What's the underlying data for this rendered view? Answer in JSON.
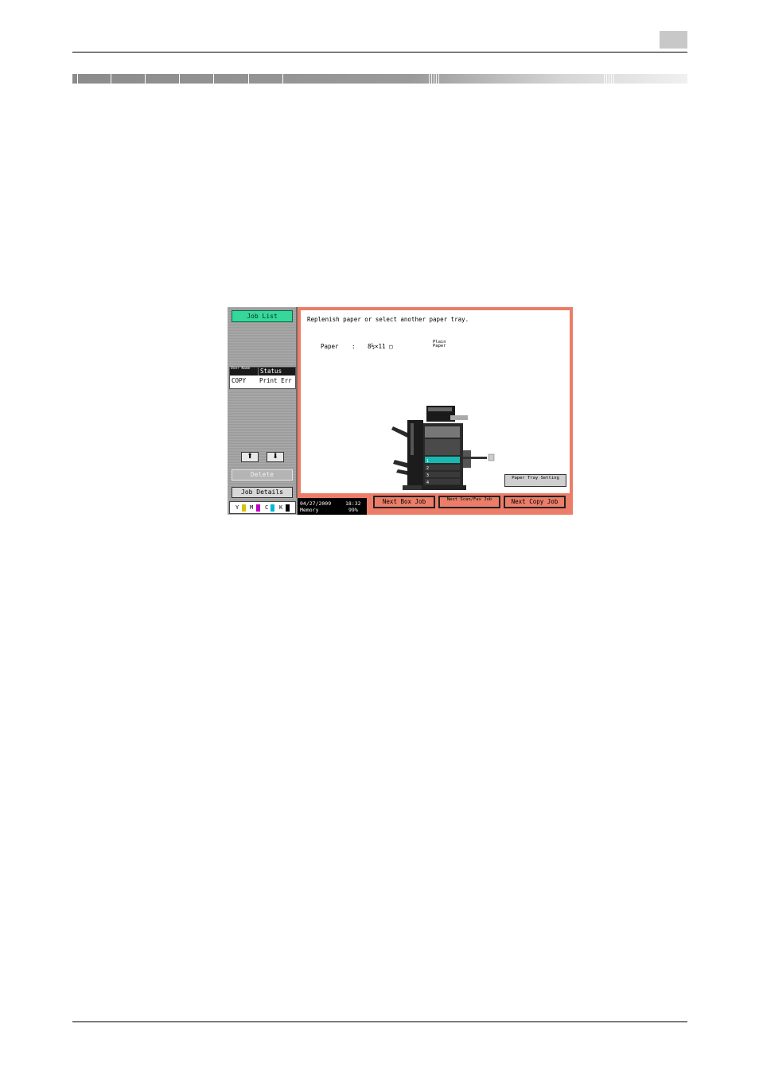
{
  "screen": {
    "left_panel": {
      "job_list_button": "Job List",
      "table": {
        "header_user": "User Name",
        "header_status": "Status",
        "row_user": "COPY",
        "row_status": "Print Err"
      },
      "scroll_up": "⬆",
      "scroll_down": "⬇",
      "delete_button": "Delete",
      "job_details_button": "Job Details",
      "toner": {
        "y": "Y",
        "m": "M",
        "c": "C",
        "k": "K",
        "colors": {
          "y": "#d4c400",
          "m": "#c000c8",
          "c": "#00b8d4",
          "k": "#000000"
        }
      }
    },
    "status_bar": {
      "date": "04/27/2009",
      "time": "18:32",
      "memory_label": "Memory",
      "memory_value": "99%"
    },
    "message": {
      "text": "Replenish paper or select another paper tray.",
      "paper_label": "Paper",
      "paper_colon": ":",
      "paper_size": "8½×11 ▢",
      "paper_type": "Plain Paper"
    },
    "paper_tray_setting_button": "Paper Tray Setting",
    "bottom_buttons": {
      "next_box_job": "Next Box Job",
      "next_scan_fax_job": "Next Scan/Fax Job",
      "next_copy_job": "Next Copy Job"
    },
    "accent_colors": {
      "frame": "#ec7d68",
      "job_list": "#36d79a"
    }
  }
}
